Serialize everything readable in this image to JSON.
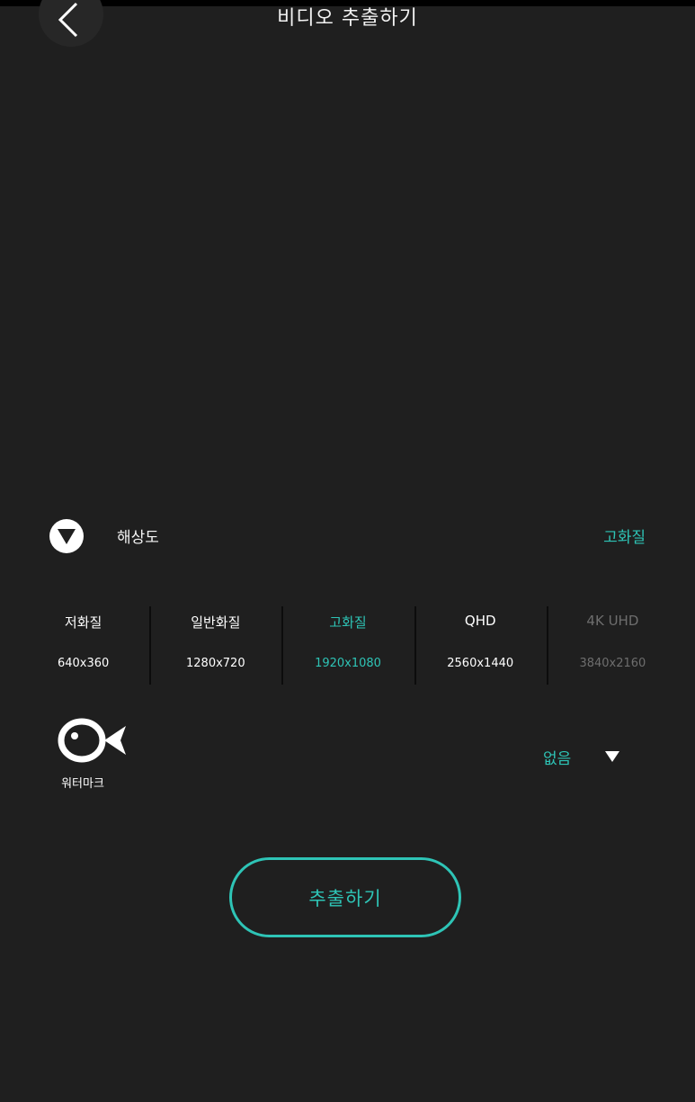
{
  "header": {
    "title": "비디오 추출하기",
    "back_icon": "chevron-left-icon"
  },
  "resolution": {
    "label": "해상도",
    "current": "고화질",
    "icon": "triangle-down-circle-icon",
    "options": [
      {
        "name": "저화질",
        "size": "640x360",
        "state": "normal"
      },
      {
        "name": "일반화질",
        "size": "1280x720",
        "state": "normal"
      },
      {
        "name": "고화질",
        "size": "1920x1080",
        "state": "selected"
      },
      {
        "name": "QHD",
        "size": "2560x1440",
        "state": "normal"
      },
      {
        "name": "4K UHD",
        "size": "3840x2160",
        "state": "disabled"
      }
    ]
  },
  "watermark": {
    "label": "워터마크",
    "icon": "fish-icon",
    "value": "없음",
    "caret_icon": "caret-down-icon"
  },
  "extract_button": {
    "label": "추출하기"
  },
  "colors": {
    "accent": "#2ec4b6",
    "background": "#1f1f1f",
    "disabled": "#6e6e6e"
  }
}
